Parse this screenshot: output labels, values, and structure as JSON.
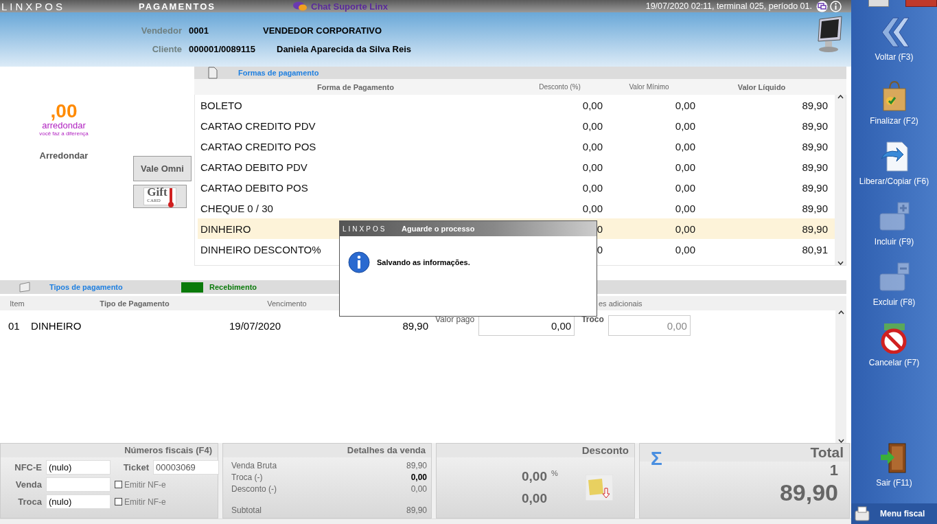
{
  "topbar": {
    "logo": "LINXPOS",
    "title": "PAGAMENTOS",
    "chat": "Chat Suporte Linx",
    "status": "19/07/2020 02:11, terminal 025, período 01."
  },
  "header": {
    "vendedor_label": "Vendedor",
    "vendedor_code": "0001",
    "vendedor_name": "VENDEDOR CORPORATIVO",
    "cliente_label": "Cliente",
    "cliente_code": "000001/0089115",
    "cliente_name": "Daniela  Aparecida da Silva Reis"
  },
  "round": {
    "logo_value": ",00",
    "logo_word": "arredondar",
    "logo_tagline": "você faz a diferença",
    "label": "Arredondar"
  },
  "vale_omni": "Vale Omni",
  "gift_card": {
    "word": "Gift",
    "small": "CARD"
  },
  "formas": {
    "title": "Formas de pagamento",
    "columns": [
      "Forma de Pagamento",
      "Desconto (%)",
      "Valor Mínimo",
      "Valor Líquido"
    ],
    "rows": [
      {
        "name": "BOLETO",
        "desconto": "0,00",
        "minimo": "0,00",
        "liquido": "89,90",
        "selected": false
      },
      {
        "name": "CARTAO CREDITO PDV",
        "desconto": "0,00",
        "minimo": "0,00",
        "liquido": "89,90",
        "selected": false
      },
      {
        "name": "CARTAO CREDITO POS",
        "desconto": "0,00",
        "minimo": "0,00",
        "liquido": "89,90",
        "selected": false
      },
      {
        "name": "CARTAO DEBITO PDV",
        "desconto": "0,00",
        "minimo": "0,00",
        "liquido": "89,90",
        "selected": false
      },
      {
        "name": "CARTAO DEBITO POS",
        "desconto": "0,00",
        "minimo": "0,00",
        "liquido": "89,90",
        "selected": false
      },
      {
        "name": "CHEQUE 0 / 30",
        "desconto": "0,00",
        "minimo": "0,00",
        "liquido": "89,90",
        "selected": false
      },
      {
        "name": "DINHEIRO",
        "desconto": "0",
        "minimo": "0,00",
        "liquido": "89,90",
        "selected": true
      },
      {
        "name": "DINHEIRO DESCONTO%",
        "desconto": "0",
        "minimo": "0,00",
        "liquido": "80,91",
        "selected": false
      }
    ]
  },
  "tipos": {
    "title": "Tipos de pagamento",
    "recebimento": "Recebimento",
    "columns": [
      "Item",
      "Tipo de Pagamento",
      "Vencimento",
      "es adicionais"
    ],
    "rows": [
      {
        "item": "01",
        "tipo": "DINHEIRO",
        "vencimento": "19/07/2020",
        "valor": "89,90",
        "valor_pago_label": "Valor pago",
        "valor_pago": "0,00",
        "troco_label": "Troco",
        "troco": "0,00"
      }
    ]
  },
  "fiscal": {
    "title": "Números fiscais (F4)",
    "nfce_label": "NFC-E",
    "nfce": "(nulo)",
    "ticket_label": "Ticket",
    "ticket": "00003069",
    "venda_label": "Venda",
    "troca_label": "Troca",
    "troca": "(nulo)",
    "emitir": [
      {
        "label": "Emitir NF-e",
        "checked": false
      },
      {
        "label": "Emitir NF-e",
        "checked": false
      }
    ]
  },
  "detalhes": {
    "title": "Detalhes da venda",
    "lines": [
      {
        "label": "Venda Bruta",
        "value": "89,90",
        "kind": "normal"
      },
      {
        "label": "Troca (-)",
        "value": "0,00",
        "kind": "strong"
      },
      {
        "label": "Desconto (-)",
        "value": "0,00",
        "kind": "normal"
      },
      {
        "label": "Subtotal",
        "value": "89,90",
        "kind": "subtotal"
      }
    ]
  },
  "desconto": {
    "title": "Desconto",
    "percent": "0,00",
    "percent_sign": "%",
    "value": "0,00"
  },
  "total": {
    "title": "Total",
    "sigma": "Σ",
    "count": "1",
    "value": "89,90"
  },
  "sidebar": {
    "actions": [
      {
        "label": "Voltar (F3)",
        "disabled": false
      },
      {
        "label": "Finalizar (F2)",
        "disabled": false
      },
      {
        "label": "Liberar/Copiar (F6)",
        "disabled": false
      },
      {
        "label": "Incluir (F9)",
        "disabled": true
      },
      {
        "label": "Excluir (F8)",
        "disabled": true
      },
      {
        "label": "Cancelar (F7)",
        "disabled": false
      }
    ],
    "exit": "Sair (F11)",
    "menu": "Menu fiscal"
  },
  "dialog": {
    "logo": "LINXPOS",
    "title": "Aguarde o processo",
    "message": "Salvando as informações."
  }
}
